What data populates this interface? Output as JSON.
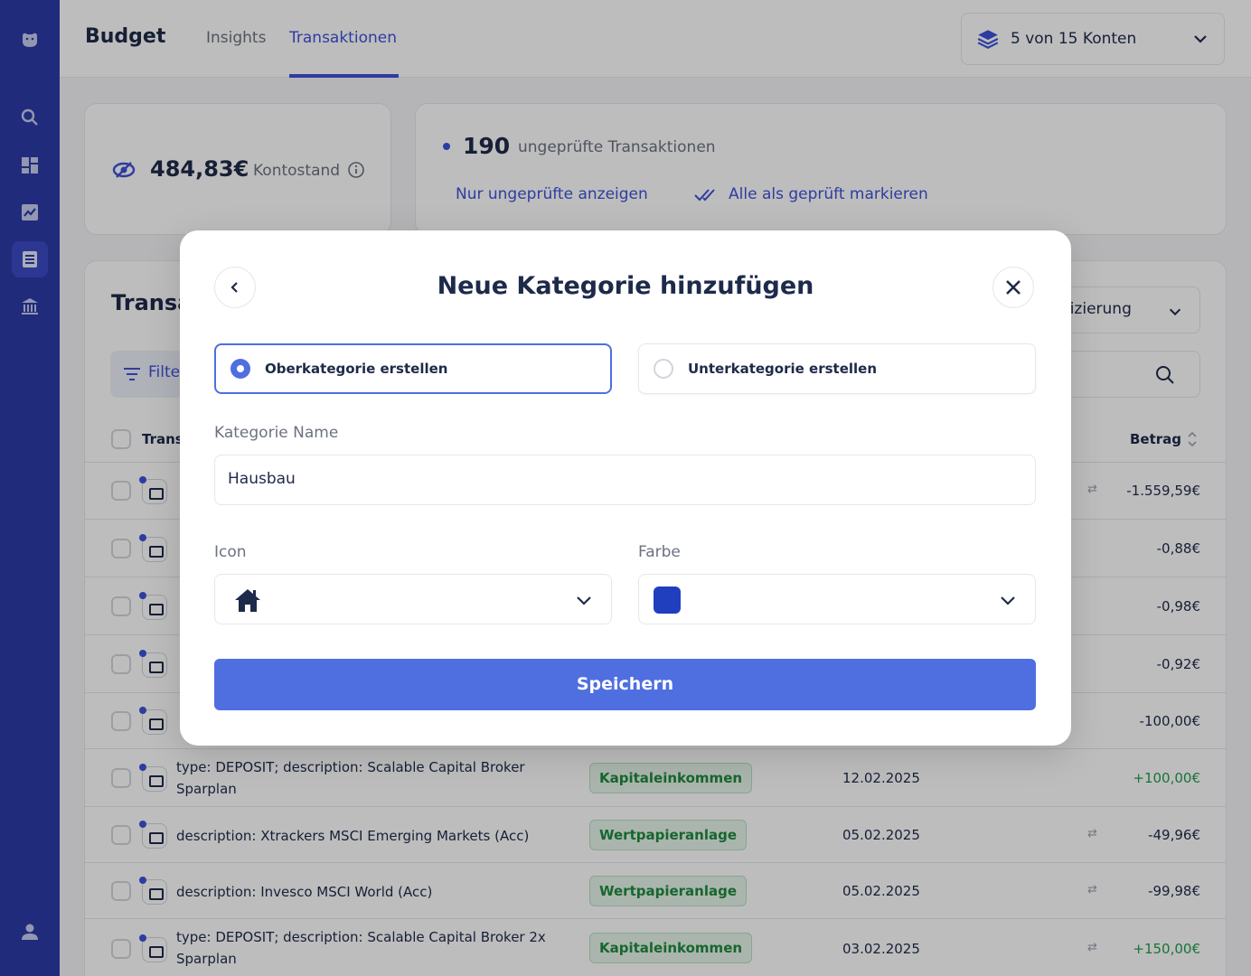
{
  "header": {
    "brand": "Budget",
    "tabs": [
      {
        "label": "Insights"
      },
      {
        "label": "Transaktionen"
      }
    ],
    "account_selector": "5 von 15 Konten"
  },
  "balance_card": {
    "amount": "484,83€",
    "label": "Kontostand"
  },
  "unchecked_card": {
    "count": "190",
    "text": "ungeprüfte Transaktionen",
    "show_unchecked_link": "Nur ungeprüfte anzeigen",
    "mark_all_link": "Alle als geprüft markieren"
  },
  "transactions": {
    "title": "Transa",
    "filter_label": "Filte",
    "verify_label": "ifizierung",
    "col_transaction": "Trans",
    "col_amount": "Betrag",
    "rows": [
      {
        "desc": "",
        "badge": "",
        "date": "",
        "amount": "-1.559,59€"
      },
      {
        "desc": "",
        "badge": "",
        "date": "",
        "amount": "-0,88€"
      },
      {
        "desc": "",
        "badge": "",
        "date": "",
        "amount": "-0,98€"
      },
      {
        "desc": "",
        "badge": "",
        "date": "",
        "amount": "-0,92€"
      },
      {
        "desc": "",
        "badge": "",
        "date": "",
        "amount": "-100,00€"
      },
      {
        "desc": "type: DEPOSIT; description: Scalable Capital Broker Sparplan",
        "badge": "Kapitaleinkommen",
        "date": "12.02.2025",
        "amount": "+100,00€"
      },
      {
        "desc": "description: Xtrackers MSCI Emerging Markets (Acc)",
        "badge": "Wertpapieranlage",
        "date": "05.02.2025",
        "amount": "-49,96€"
      },
      {
        "desc": "description: Invesco MSCI World (Acc)",
        "badge": "Wertpapieranlage",
        "date": "05.02.2025",
        "amount": "-99,98€"
      },
      {
        "desc": "type: DEPOSIT; description: Scalable Capital Broker 2x Sparplan",
        "badge": "Kapitaleinkommen",
        "date": "03.02.2025",
        "amount": "+150,00€"
      }
    ]
  },
  "modal": {
    "title": "Neue Kategorie hinzufügen",
    "option_parent": "Oberkategorie erstellen",
    "option_child": "Unterkategorie erstellen",
    "selected_option": "parent",
    "name_label": "Kategorie Name",
    "name_value": "Hausbau",
    "icon_label": "Icon",
    "icon_value": "home-icon",
    "color_label": "Farbe",
    "color_value": "#1f3fbf",
    "save_label": "Speichern"
  },
  "colors": {
    "accent": "#3f51d9",
    "sidebar": "#2c3aa8",
    "button": "#4f6ee0",
    "positive": "#1f9d4b"
  }
}
